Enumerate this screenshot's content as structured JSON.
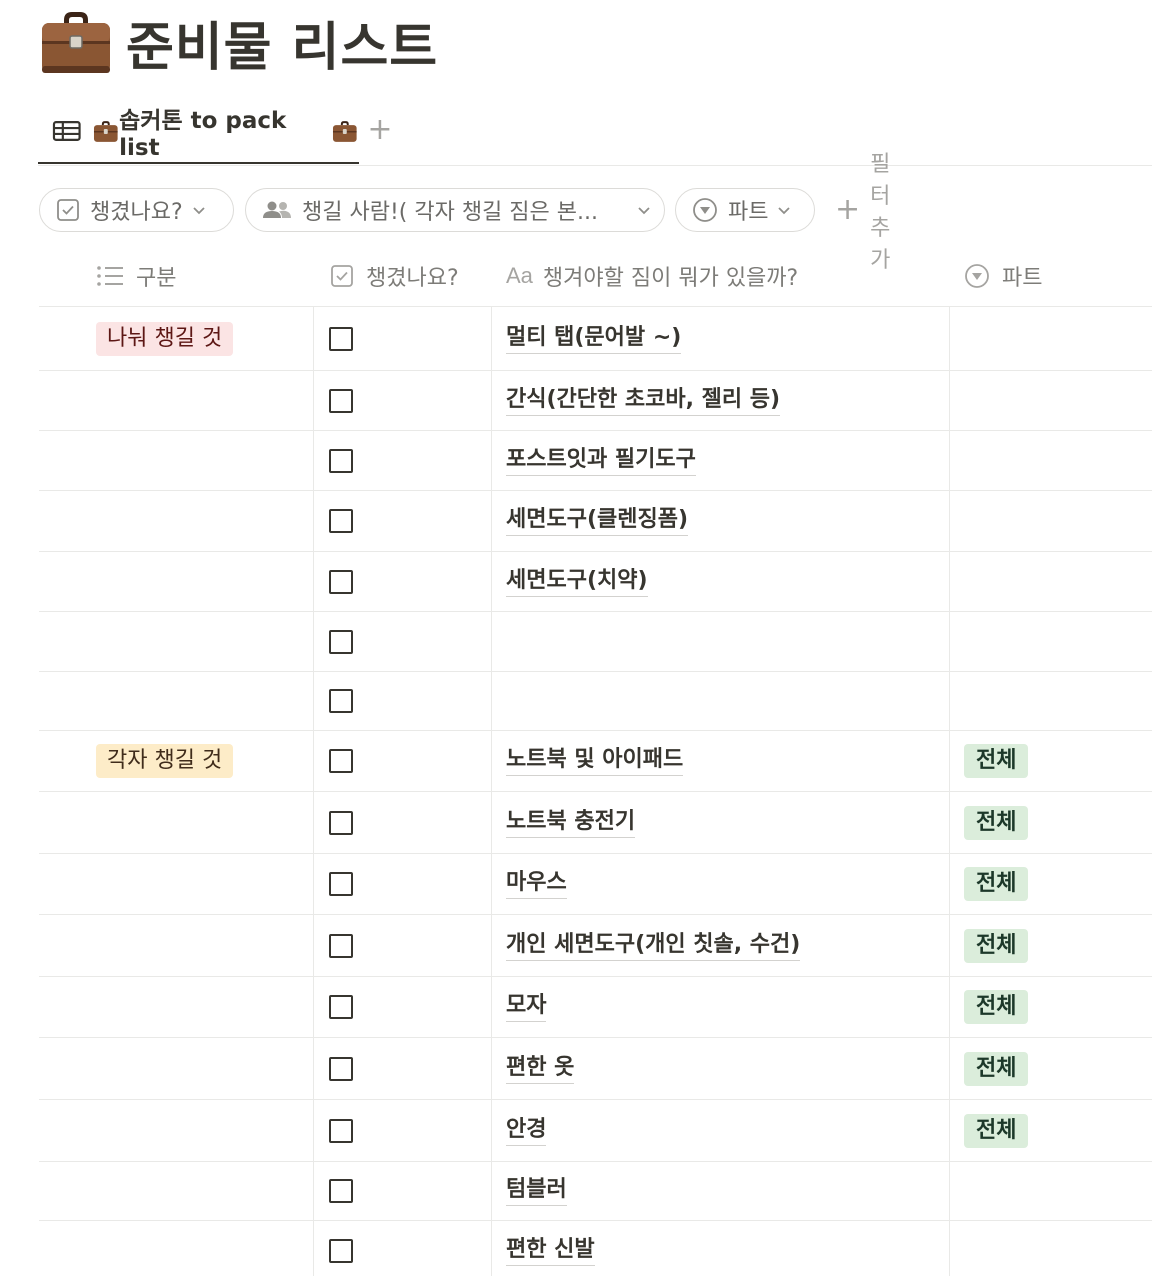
{
  "page": {
    "title": "준비물 리스트",
    "title_icon": "briefcase-icon"
  },
  "view_tab": {
    "label": "솝커톤 to pack list",
    "icon": "table-icon",
    "add_label": "+"
  },
  "filters": {
    "chips": [
      {
        "label": "챙겼나요?",
        "icon": "checkbox-icon"
      },
      {
        "label": "챙길 사람!( 각자 챙길 짐은 본...",
        "icon": "people-icon"
      },
      {
        "label": "파트",
        "icon": "select-icon"
      }
    ],
    "add_filter_label": "필터 추가"
  },
  "columns": [
    {
      "label": "구분",
      "icon": "list-icon"
    },
    {
      "label": "챙겼나요?",
      "icon": "checkbox-icon"
    },
    {
      "label": "챙겨야할 짐이 뭐가 있을까?",
      "icon": "text-aa-icon",
      "prefix": "Aa"
    },
    {
      "label": "파트",
      "icon": "select-icon"
    }
  ],
  "category_colors": {
    "나눠 챙길 것": {
      "bg": "#fbe4e4",
      "fg": "#5d1715"
    },
    "각자 챙길 것": {
      "bg": "#fdecc8",
      "fg": "#402c1b"
    }
  },
  "rows": [
    {
      "category": "나눠 챙길 것",
      "checked": false,
      "name": "멀티 탭(문어발 ~)",
      "part": ""
    },
    {
      "category": "",
      "checked": false,
      "name": "간식(간단한 초코바, 젤리 등)",
      "part": ""
    },
    {
      "category": "",
      "checked": false,
      "name": "포스트잇과 필기도구",
      "part": ""
    },
    {
      "category": "",
      "checked": false,
      "name": "세면도구(클렌징폼)",
      "part": ""
    },
    {
      "category": "",
      "checked": false,
      "name": "세면도구(치약)",
      "part": ""
    },
    {
      "category": "",
      "checked": false,
      "name": "",
      "part": ""
    },
    {
      "category": "",
      "checked": false,
      "name": "",
      "part": ""
    },
    {
      "category": "각자 챙길 것",
      "checked": false,
      "name": "노트북 및 아이패드",
      "part": "전체"
    },
    {
      "category": "",
      "checked": false,
      "name": "노트북 충전기",
      "part": "전체"
    },
    {
      "category": "",
      "checked": false,
      "name": "마우스",
      "part": "전체"
    },
    {
      "category": "",
      "checked": false,
      "name": "개인 세면도구(개인 칫솔, 수건)",
      "part": "전체"
    },
    {
      "category": "",
      "checked": false,
      "name": "모자",
      "part": "전체"
    },
    {
      "category": "",
      "checked": false,
      "name": "편한 옷",
      "part": "전체"
    },
    {
      "category": "",
      "checked": false,
      "name": "안경",
      "part": "전체"
    },
    {
      "category": "",
      "checked": false,
      "name": "텀블러",
      "part": ""
    },
    {
      "category": "",
      "checked": false,
      "name": "편한 신발",
      "part": ""
    }
  ]
}
